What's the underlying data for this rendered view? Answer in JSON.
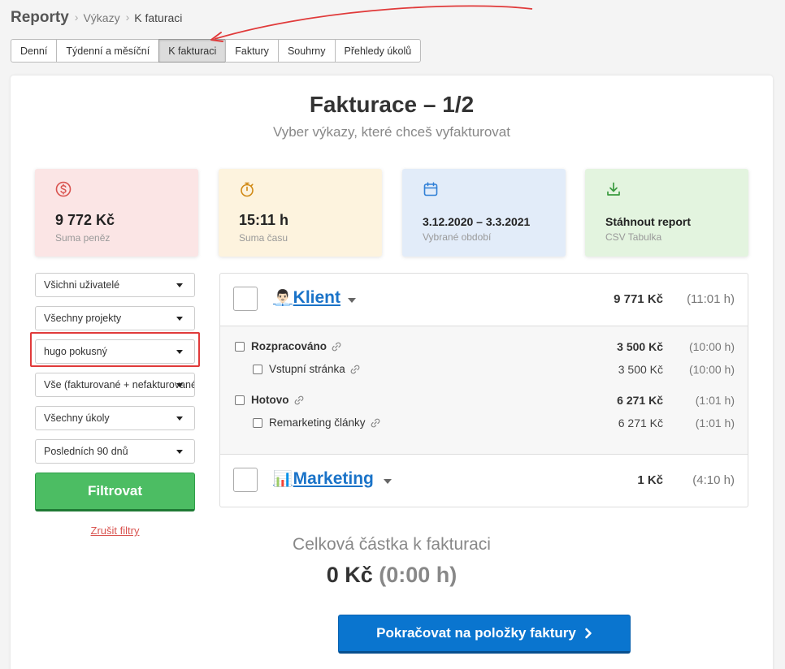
{
  "breadcrumb": {
    "root": "Reporty",
    "items": [
      "Výkazy",
      "K faturaci"
    ]
  },
  "tabs": [
    "Denní",
    "Týdenní a měsíční",
    "K fakturaci",
    "Faktury",
    "Souhrny",
    "Přehledy úkolů"
  ],
  "active_tab": "K fakturaci",
  "page": {
    "title": "Fakturace – 1/2",
    "subtitle": "Vyber výkazy, které chceš vyfakturovat"
  },
  "stats": [
    {
      "icon": "dollar-icon",
      "value": "9 772 Kč",
      "label": "Suma peněz",
      "color": "#fbe5e5"
    },
    {
      "icon": "stopwatch-icon",
      "value": "15:11 h",
      "label": "Suma času",
      "color": "#fdf3de"
    },
    {
      "icon": "calendar-icon",
      "value": "3.12.2020 – 3.3.2021",
      "label": "Vybrané období",
      "color": "#e2ecf9"
    },
    {
      "icon": "download-icon",
      "value": "Stáhnout report",
      "label": "CSV Tabulka",
      "color": "#e3f4df"
    }
  ],
  "filters": [
    "Všichni uživatelé",
    "Všechny projekty",
    "hugo pokusný",
    "Vše (fakturované + nefakturované)",
    "Všechny úkoly",
    "Posledních 90 dnů"
  ],
  "filter_button": "Filtrovat",
  "clear_filters": "Zrušit filtry",
  "projects": [
    {
      "emoji": "👨🏻‍💼",
      "name": "Klient",
      "amount": "9 771 Kč",
      "hours": "(11:01 h)",
      "groups": [
        {
          "name": "Rozpracováno",
          "amount": "3 500 Kč",
          "hours": "(10:00 h)",
          "tasks": [
            {
              "name": "Vstupní stránka",
              "amount": "3 500 Kč",
              "hours": "(10:00 h)"
            }
          ]
        },
        {
          "name": "Hotovo",
          "amount": "6 271 Kč",
          "hours": "(1:01 h)",
          "tasks": [
            {
              "name": "Remarketing články",
              "amount": "6 271 Kč",
              "hours": "(1:01 h)"
            }
          ]
        }
      ]
    },
    {
      "emoji": "📊",
      "name": "Marketing",
      "amount": "1 Kč",
      "hours": "(4:10 h)"
    }
  ],
  "total": {
    "label": "Celková částka k fakturaci",
    "amount": "0 Kč",
    "hours": "(0:00 h)"
  },
  "continue_button": "Pokračovat na položky faktury",
  "colors": {
    "accent_blue": "#0a75cf",
    "green": "#4cbd63",
    "annotation_red": "#e03a3a",
    "danger": "#d9534f"
  }
}
